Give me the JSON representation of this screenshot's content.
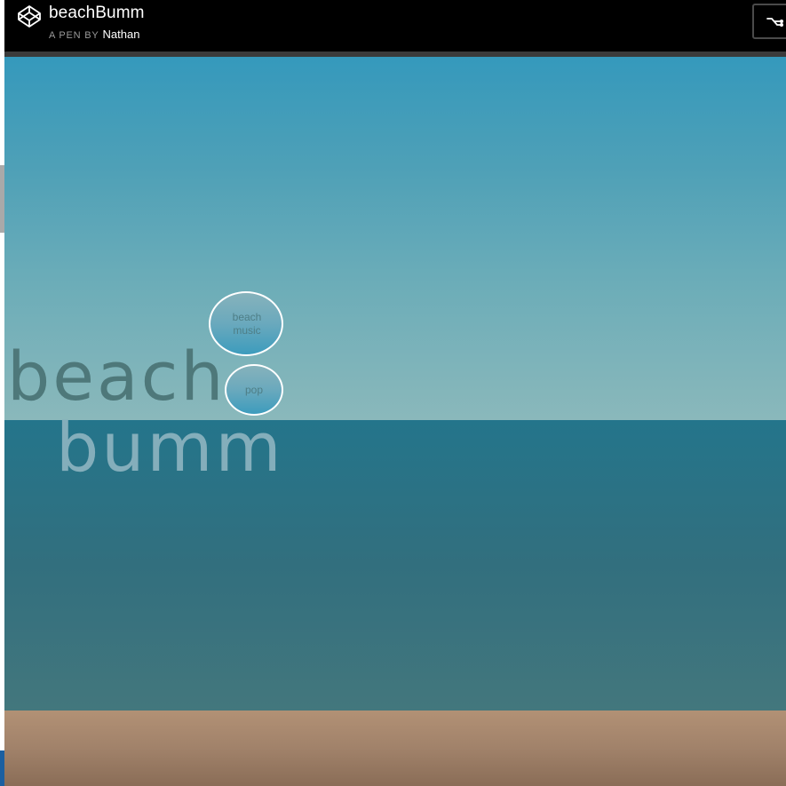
{
  "header": {
    "title": "beachBumm",
    "byline_prefix": "A PEN BY",
    "author": "Nathan"
  },
  "scene": {
    "bubbles": [
      {
        "label": "beach music"
      },
      {
        "label": "pop"
      }
    ],
    "logo_text": {
      "line1": "beach",
      "line2": "bumm"
    }
  },
  "icons": {
    "logo": "codepen-logo-icon",
    "fork": "fork-icon"
  },
  "colors": {
    "header_bg": "#000000",
    "sky_top": "#3599bc",
    "sky_bottom": "#8ab8bb",
    "sea": "#2f7080",
    "sand": "#a1826a",
    "beach_word": "#4e787a",
    "bumm_word": "#84aebb"
  }
}
